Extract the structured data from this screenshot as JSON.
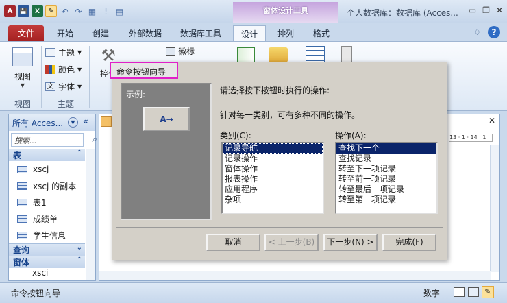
{
  "titlebar": {
    "context_tab": "窗体设计工具",
    "window_title": "个人数据库：数据库 (Acces...",
    "qat": {
      "access": "A",
      "save": "💾",
      "excel": "X",
      "active": "✎",
      "undo": "↶",
      "redo": "↷",
      "table_icon": "▦",
      "bang": "!",
      "grid": "▤"
    },
    "controls": {
      "minimize": "▭",
      "restore": "❐",
      "close": "✕"
    }
  },
  "tabs": [
    {
      "label": "文件",
      "name": "tab-file"
    },
    {
      "label": "开始",
      "name": "tab-home"
    },
    {
      "label": "创建",
      "name": "tab-create"
    },
    {
      "label": "外部数据",
      "name": "tab-external-data"
    },
    {
      "label": "数据库工具",
      "name": "tab-database-tools"
    },
    {
      "label": "设计",
      "name": "tab-design"
    },
    {
      "label": "排列",
      "name": "tab-arrange"
    },
    {
      "label": "格式",
      "name": "tab-format"
    }
  ],
  "help": {
    "collapse": "♢",
    "help": "?"
  },
  "ribbon": {
    "view_label": "视图",
    "view_group": "视图",
    "theme_label": "主题",
    "color_label": "颜色",
    "font_label": "字体",
    "theme_group": "主题",
    "control_label": "控件",
    "logo_label": "徽标"
  },
  "nav": {
    "header": "所有 Acces...",
    "search_placeholder": "搜索...",
    "groups": {
      "tables": "表",
      "queries": "查询",
      "forms": "窗体"
    },
    "table_items": [
      "xscj",
      "xscj 的副本",
      "表1",
      "成绩单",
      "学生信息"
    ],
    "form_item_partial": "xscj"
  },
  "status": {
    "left": "命令按钮向导",
    "mode": "数字"
  },
  "dialog": {
    "title": "命令按钮向导",
    "example_label": "示例:",
    "instruction": "请选择按下按钮时执行的操作:",
    "note": "针对每一类别，可有多种不同的操作。",
    "category_label": "类别(C):",
    "action_label": "操作(A):",
    "categories": [
      "记录导航",
      "记录操作",
      "窗体操作",
      "报表操作",
      "应用程序",
      "杂项"
    ],
    "actions": [
      "查找下一个",
      "查找记录",
      "转至下一项记录",
      "转至前一项记录",
      "转至最后一项记录",
      "转至第一项记录"
    ],
    "buttons": {
      "cancel": "取消",
      "back": "< 上一步(B)",
      "next": "下一步(N) >",
      "finish": "完成(F)"
    }
  },
  "colors": {
    "accent_pink": "#e020c8",
    "selection": "#0a246a",
    "file_tab": "#a52121"
  }
}
